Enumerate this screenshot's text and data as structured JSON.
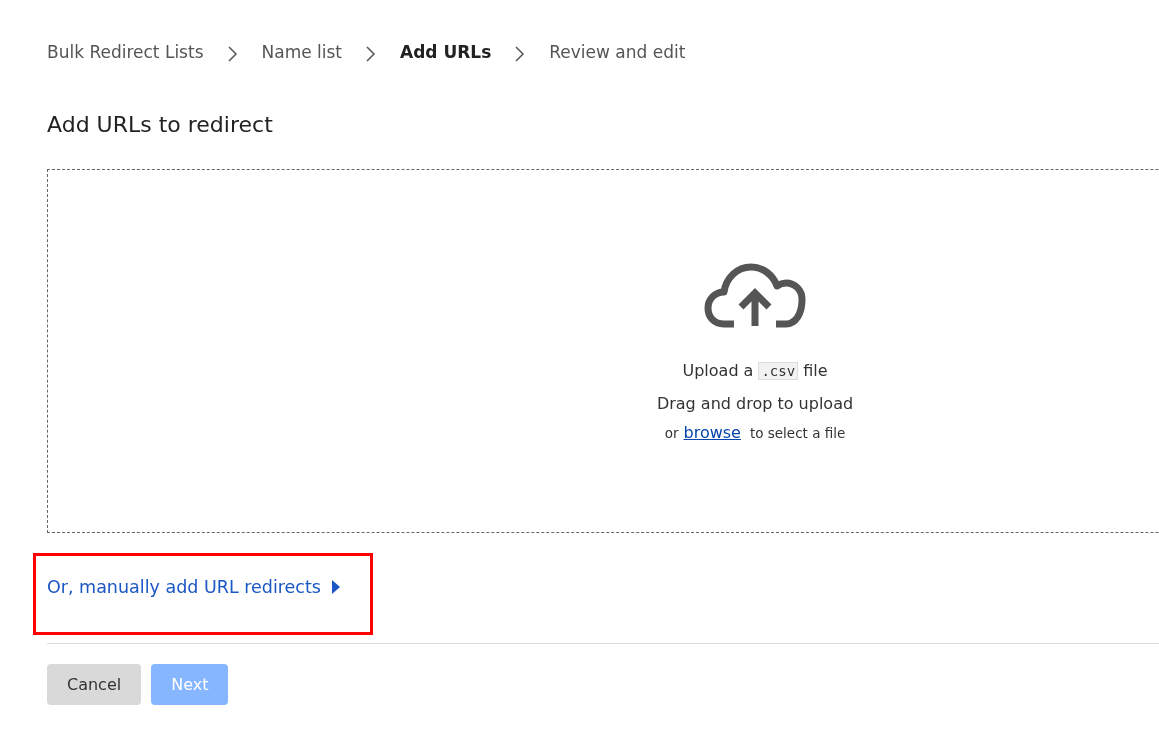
{
  "breadcrumb": [
    {
      "label": "Bulk Redirect Lists",
      "selected": false
    },
    {
      "label": "Name list",
      "selected": false
    },
    {
      "label": "Add URLs",
      "selected": true
    },
    {
      "label": "Review and edit",
      "selected": false
    }
  ],
  "title": "Add URLs to redirect",
  "dropzone": {
    "upload_prefix": "Upload a",
    "file_type": ".csv",
    "upload_suffix": "file",
    "drag_text": "Drag and drop to upload",
    "or_text": "or",
    "browse_link": "browse",
    "select_text": "to select a file"
  },
  "manual_toggle": {
    "label": "Or, manually add URL redirects",
    "expanded": false,
    "highlighted": true
  },
  "buttons": [
    {
      "label": "Cancel",
      "kind": "secondary",
      "disabled": false
    },
    {
      "label": "Next",
      "kind": "primary",
      "disabled": true
    }
  ]
}
